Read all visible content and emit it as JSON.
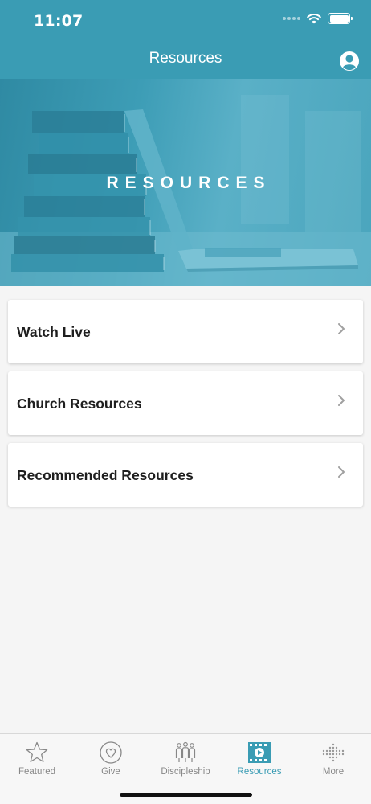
{
  "status_bar": {
    "time": "11:07"
  },
  "header": {
    "title": "Resources"
  },
  "hero": {
    "title": "RESOURCES"
  },
  "menu": [
    {
      "label": "Watch Live"
    },
    {
      "label": "Church Resources"
    },
    {
      "label": "Recommended Resources"
    }
  ],
  "tabbar": {
    "tabs": [
      {
        "label": "Featured",
        "icon": "star-icon"
      },
      {
        "label": "Give",
        "icon": "heart-icon"
      },
      {
        "label": "Discipleship",
        "icon": "people-icon"
      },
      {
        "label": "Resources",
        "icon": "video-icon",
        "active": true
      },
      {
        "label": "More",
        "icon": "dots-grid-icon"
      }
    ]
  },
  "colors": {
    "accent": "#3a9cb4",
    "inactive": "#888888",
    "background": "#f5f5f5"
  }
}
